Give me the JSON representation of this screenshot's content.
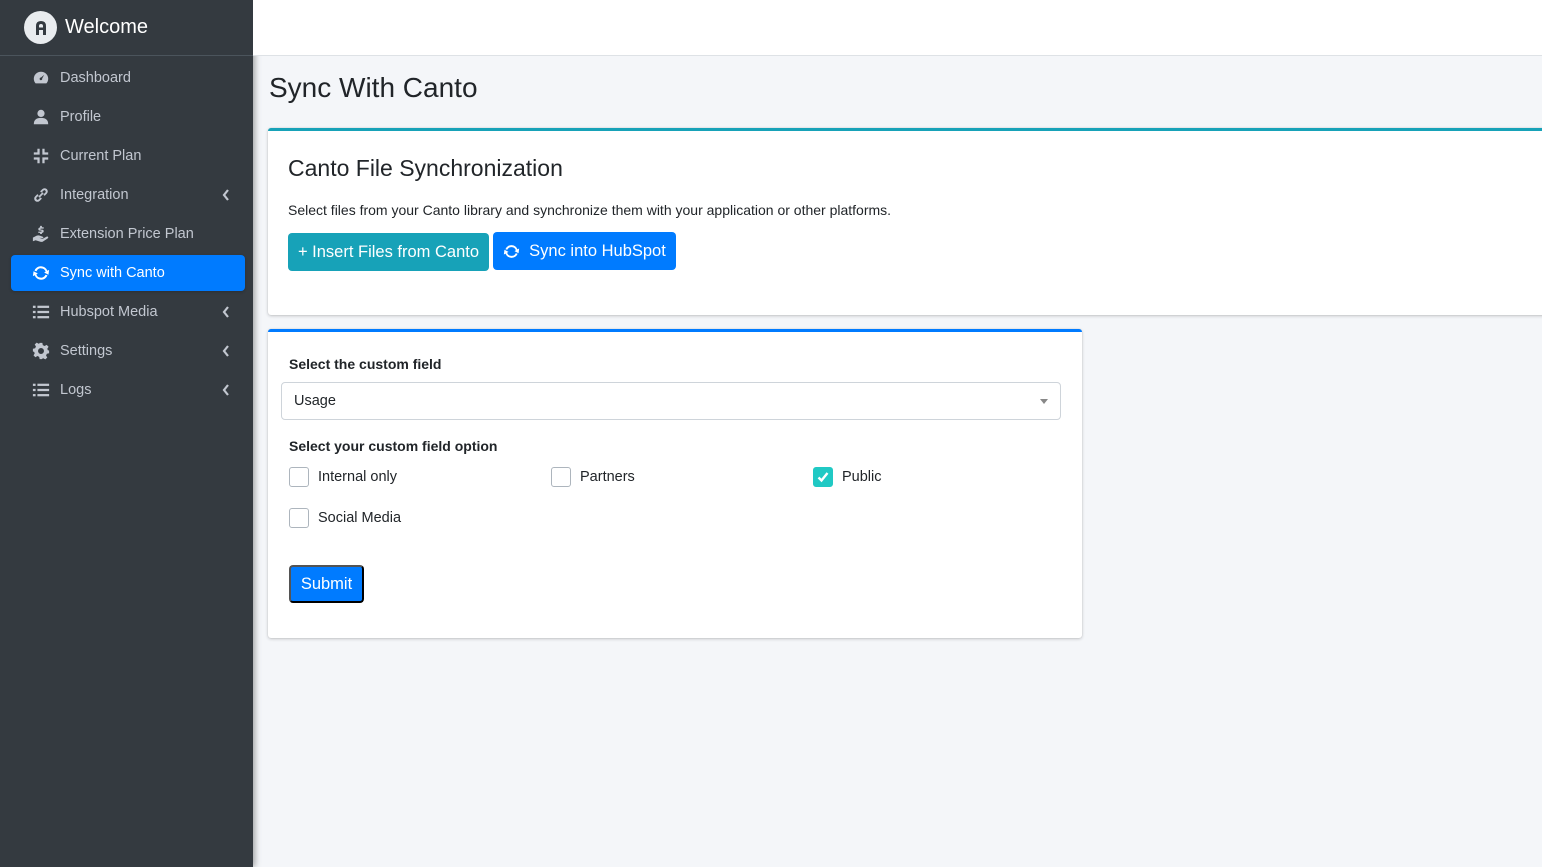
{
  "brand": {
    "title": "Welcome"
  },
  "sidebar": {
    "items": [
      {
        "label": "Dashboard",
        "icon": "dashboard-icon",
        "active": false,
        "has_chevron": false
      },
      {
        "label": "Profile",
        "icon": "user-icon",
        "active": false,
        "has_chevron": false
      },
      {
        "label": "Current Plan",
        "icon": "compress-icon",
        "active": false,
        "has_chevron": false
      },
      {
        "label": "Integration",
        "icon": "link-icon",
        "active": false,
        "has_chevron": true
      },
      {
        "label": "Extension Price Plan",
        "icon": "hand-dollar-icon",
        "active": false,
        "has_chevron": false
      },
      {
        "label": "Sync with Canto",
        "icon": "sync-icon",
        "active": true,
        "has_chevron": false
      },
      {
        "label": "Hubspot Media",
        "icon": "list-icon",
        "active": false,
        "has_chevron": true
      },
      {
        "label": "Settings",
        "icon": "gear-icon",
        "active": false,
        "has_chevron": true
      },
      {
        "label": "Logs",
        "icon": "list-icon",
        "active": false,
        "has_chevron": true
      }
    ]
  },
  "main": {
    "page_title": "Sync With Canto",
    "sync_card": {
      "title": "Canto File Synchronization",
      "description": "Select files from your Canto library and synchronize them with your application or other platforms.",
      "insert_button": "+ Insert Files from Canto",
      "sync_button": "Sync into HubSpot"
    },
    "form_card": {
      "field_label": "Select the custom field",
      "field_value": "Usage",
      "option_label": "Select your custom field option",
      "options": [
        {
          "label": "Internal only",
          "checked": false
        },
        {
          "label": "Partners",
          "checked": false
        },
        {
          "label": "Public",
          "checked": true
        },
        {
          "label": "Social Media",
          "checked": false
        }
      ],
      "submit_button": "Submit"
    }
  },
  "colors": {
    "sidebar_bg": "#343a40",
    "primary": "#007bff",
    "info": "#17a2b8",
    "checked": "#20c9c4"
  }
}
